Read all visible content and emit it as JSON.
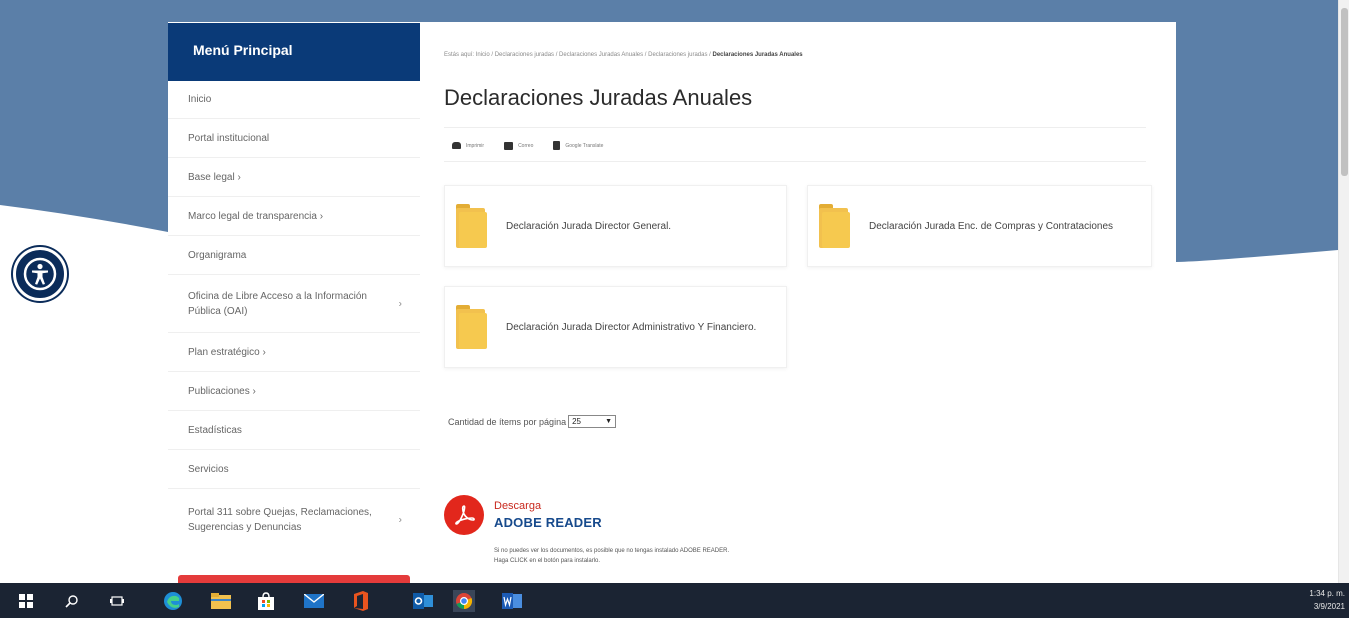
{
  "sidebar": {
    "title": "Menú Principal",
    "items": [
      {
        "label": "Inicio",
        "chevron": ""
      },
      {
        "label": "Portal institucional",
        "chevron": ""
      },
      {
        "label": "Base legal ›",
        "chevron": ""
      },
      {
        "label": "Marco legal de transparencia ›",
        "chevron": ""
      },
      {
        "label": "Organigrama",
        "chevron": ""
      },
      {
        "label": "Oficina de Libre Acceso a la Información Pública (OAI)",
        "chevron": "›"
      },
      {
        "label": "Plan estratégico ›",
        "chevron": ""
      },
      {
        "label": "Publicaciones ›",
        "chevron": ""
      },
      {
        "label": "Estadísticas",
        "chevron": ""
      },
      {
        "label": "Servicios",
        "chevron": ""
      },
      {
        "label": "Portal 311 sobre Quejas, Reclamaciones, Sugerencias y Denuncias",
        "chevron": "›"
      }
    ]
  },
  "breadcrumb": {
    "prefix": "Estás aquí: ",
    "path": "Inicio / Declaraciones juradas / Declaraciones Juradas Anuales / Declaraciones juradas / ",
    "current": "Declaraciones Juradas Anuales"
  },
  "page": {
    "title": "Declaraciones Juradas Anuales"
  },
  "toolbar": {
    "print_label": "Imprimir",
    "email_label": "Correo",
    "translate_label": "Google Translate"
  },
  "documents": [
    "Declaración Jurada Director General.",
    "Declaración Jurada Enc. de Compras y Contrataciones",
    "Declaración Jurada Director Administrativo Y Financiero."
  ],
  "pagination": {
    "label": "Cantidad de ítems por página",
    "value": "25"
  },
  "adobe": {
    "download": "Descarga",
    "reader": "ADOBE READER",
    "note_line1": "Si no puedes ver los documentos, es posible que no tengas instalado ADOBE READER.",
    "note_line2": "Haga CLICK en el botón para instalarlo."
  },
  "taskbar": {
    "time": "1:34 p. m.",
    "date": "3/9/2021"
  },
  "colors": {
    "brand_navy": "#0a3a78",
    "background_blue": "#5b7fa8",
    "folder_yellow": "#f6c94f",
    "adobe_red": "#e2271c",
    "taskbar": "#1b2433"
  }
}
